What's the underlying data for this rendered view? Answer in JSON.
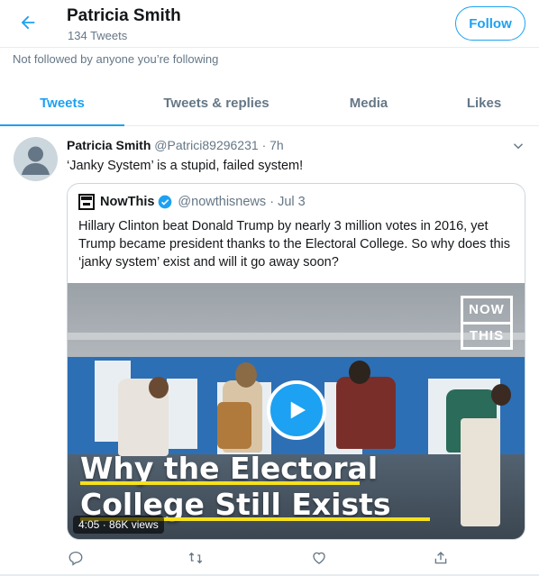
{
  "header": {
    "name": "Patricia Smith",
    "tweet_count": "134 Tweets",
    "follow_label": "Follow",
    "back_icon": "arrow-left-icon"
  },
  "profile": {
    "followed_note": "Not followed by anyone you’re following"
  },
  "tabs": [
    {
      "label": "Tweets",
      "active": true
    },
    {
      "label": "Tweets & replies",
      "active": false
    },
    {
      "label": "Media",
      "active": false
    },
    {
      "label": "Likes",
      "active": false
    }
  ],
  "tweet": {
    "author_name": "Patricia Smith",
    "author_handle": "@Patrici89296231",
    "separator": "·",
    "time": "7h",
    "text": "‘Janky System’ is a stupid, failed system!",
    "quote": {
      "name": "NowThis",
      "handle": "@nowthisnews",
      "separator": "·",
      "date": "Jul 3",
      "text": "Hillary Clinton beat Donald Trump by nearly 3 million votes in 2016, yet Trump became president thanks to the Electoral College. So why does this ‘janky system’ exist and will it go away soon?",
      "video": {
        "logo_line1": "NOW",
        "logo_line2": "THIS",
        "overlay_line1": "Why the Electoral",
        "overlay_line2": "College Still Exists",
        "duration": "4:05 · 86K views"
      }
    },
    "actions": [
      "reply-icon",
      "retweet-icon",
      "like-icon",
      "share-icon"
    ]
  },
  "colors": {
    "accent": "#1da1f2",
    "text": "#14171a",
    "muted": "#657786",
    "border": "#e6ecf0",
    "highlight": "#f5e11d"
  }
}
